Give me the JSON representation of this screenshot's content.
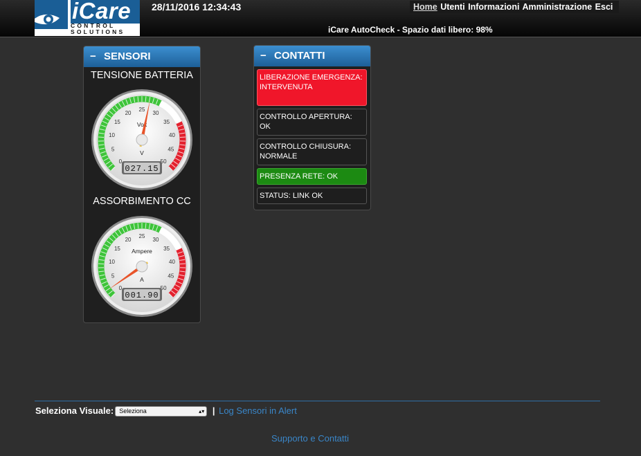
{
  "header": {
    "brand": "iCare",
    "brand_sub_1": "CONTROL",
    "brand_sub_2": "SOLUTIONS",
    "datetime": "28/11/2016 12:34:43",
    "nav": [
      "Home",
      "Utenti",
      "Informazioni",
      "Amministrazione",
      "Esci"
    ],
    "status": "iCare AutoCheck - Spazio dati libero: 98%"
  },
  "sensori": {
    "title": "SENSORI",
    "collapse": "−",
    "gauges": [
      {
        "title": "TENSIONE BATTERIA",
        "unit_label": "Volt",
        "unit": "V",
        "display": "027.15",
        "value": 27.15,
        "min": 0,
        "max": 50,
        "ticks": [
          "0",
          "5",
          "10",
          "15",
          "20",
          "25",
          "30",
          "35",
          "40",
          "45",
          "50"
        ]
      },
      {
        "title": "ASSORBIMENTO CC",
        "unit_label": "Ampere",
        "unit": "A",
        "display": "001.90",
        "value": 1.9,
        "min": 0,
        "max": 50,
        "ticks": [
          "0",
          "5",
          "10",
          "15",
          "20",
          "25",
          "30",
          "35",
          "40",
          "45",
          "50"
        ]
      }
    ]
  },
  "contatti": {
    "title": "CONTATTI",
    "collapse": "−",
    "items": [
      {
        "text": "LIBERAZIONE EMERGENZA: INTERVENUTA",
        "status": "alarm"
      },
      {
        "text": "CONTROLLO APERTURA: OK",
        "status": "normal"
      },
      {
        "text": "CONTROLLO CHIUSURA: NORMALE",
        "status": "normal"
      },
      {
        "text": "PRESENZA RETE: OK",
        "status": "ok"
      },
      {
        "text": "STATUS: LINK OK",
        "status": "normal"
      }
    ]
  },
  "footer": {
    "select_label": "Seleziona Visuale:",
    "select_value": "Seleziona",
    "separator": "|",
    "log_link": "Log Sensori in Alert",
    "support_link": "Supporto e Contatti"
  },
  "colors": {
    "panel_header": "#2a7bbd",
    "alarm": "#f0162a",
    "ok": "#1c8a12",
    "link": "#3a86c8"
  }
}
